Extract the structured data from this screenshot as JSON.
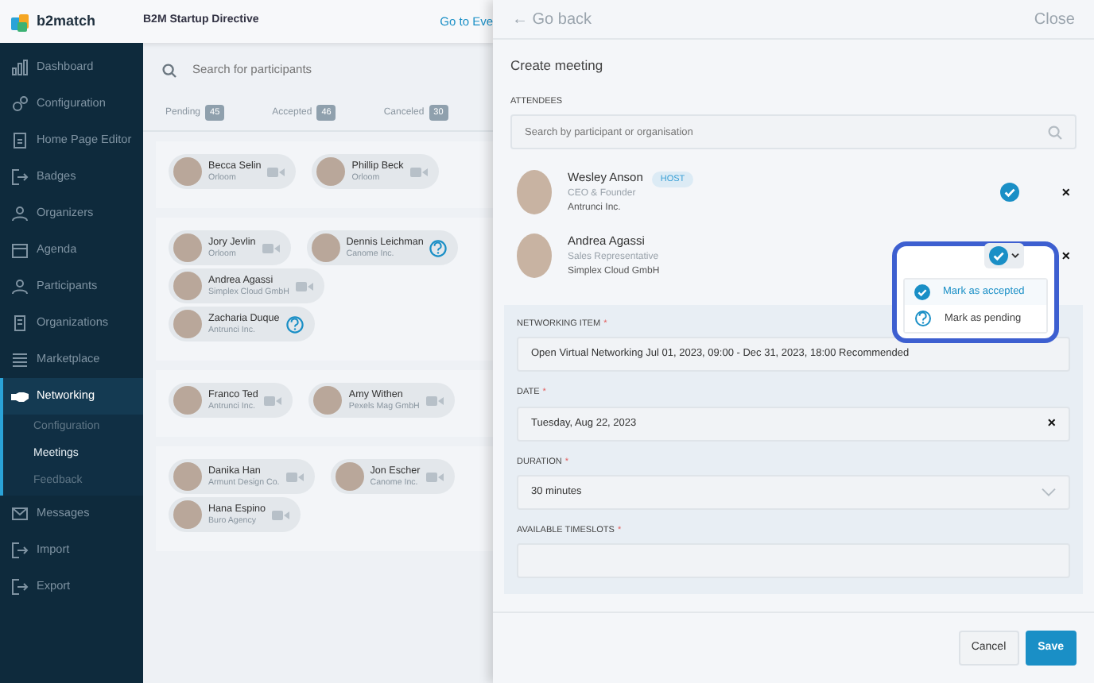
{
  "header": {
    "logo": "b2match",
    "event_title": "B2M Startup Directive",
    "link": "Go to Eve"
  },
  "sidebar": {
    "items": [
      {
        "label": "Dashboard",
        "selected": false
      },
      {
        "label": "Configuration",
        "selected": false
      },
      {
        "label": "Home Page Editor",
        "selected": false
      },
      {
        "label": "Badges",
        "selected": false
      },
      {
        "label": "Organizers",
        "selected": false
      },
      {
        "label": "Agenda",
        "selected": false
      },
      {
        "label": "Participants",
        "selected": false
      },
      {
        "label": "Organizations",
        "selected": false
      },
      {
        "label": "Marketplace",
        "selected": false
      },
      {
        "label": "Networking",
        "selected": true,
        "children": [
          {
            "label": "Configuration",
            "selected": false
          },
          {
            "label": "Meetings",
            "selected": true
          },
          {
            "label": "Feedback",
            "selected": false
          }
        ]
      },
      {
        "label": "Messages",
        "selected": false
      },
      {
        "label": "Import",
        "selected": false
      },
      {
        "label": "Export",
        "selected": false
      }
    ]
  },
  "meetings": {
    "search": {
      "placeholder": "Search for participants"
    },
    "tabs": [
      {
        "label": "Pending",
        "count": "45",
        "selected": false
      },
      {
        "label": "Accepted",
        "count": "46",
        "selected": false
      },
      {
        "label": "Canceled",
        "count": "30",
        "selected": false
      }
    ],
    "groups": [
      {
        "participants": [
          {
            "name": "Becca Selin",
            "org": "Orloom",
            "kind": "video"
          },
          {
            "name": "Phillip Beck",
            "org": "Orloom",
            "kind": "video"
          }
        ]
      },
      {
        "participants": [
          {
            "name": "Jory Jevlin",
            "org": "Orloom",
            "kind": "video"
          },
          {
            "name": "Dennis Leichman",
            "org": "Canome Inc.",
            "kind": "pending"
          },
          {
            "name": "Andrea Agassi",
            "org": "Simplex Cloud GmbH",
            "kind": "video"
          },
          {
            "name": "Zacharia Duque",
            "org": "Antrunci Inc.",
            "kind": "pending"
          }
        ]
      },
      {
        "participants": [
          {
            "name": "Franco Ted",
            "org": "Antrunci Inc.",
            "kind": "video"
          },
          {
            "name": "Amy Withen",
            "org": "Pexels Mag GmbH",
            "kind": "video"
          }
        ]
      },
      {
        "participants": [
          {
            "name": "Danika Han",
            "org": "Armunt Design Co.",
            "kind": "video"
          },
          {
            "name": "Jon Escher",
            "org": "Canome Inc.",
            "kind": "video"
          },
          {
            "name": "Hana Espino",
            "org": "Buro Agency",
            "kind": "video"
          }
        ]
      }
    ]
  },
  "panel": {
    "back": "← Go back",
    "close": "Close",
    "title": "Create meeting",
    "attendees_label": "ATTENDEES",
    "attendee_search": {
      "placeholder": "Search by participant or organisation"
    },
    "attendees": [
      {
        "name": "Wesley Anson",
        "badge": "HOST",
        "role": "CEO & Founder",
        "org": "Antrunci Inc.",
        "accepted": true,
        "expanded": false,
        "remove": "×"
      },
      {
        "name": "Andrea Agassi",
        "role": "Sales Representative",
        "org": "Simplex Cloud GmbH",
        "accepted": true,
        "expanded": true,
        "remove": "×"
      }
    ],
    "status_menu": [
      {
        "label": "Mark as accepted",
        "kind": "accepted",
        "selected": true
      },
      {
        "label": "Mark as pending",
        "kind": "pending",
        "selected": false
      }
    ],
    "fields": [
      {
        "label": "NETWORKING ITEM",
        "required_mark": "*",
        "value": "Open Virtual Networking Jul 01, 2023, 09:00 - Dec 31, 2023, 18:00 Recommended",
        "kind": "text"
      },
      {
        "label": "DATE",
        "required_mark": "*",
        "value": "Tuesday, Aug 22, 2023",
        "kind": "clearable",
        "clear": "×"
      },
      {
        "label": "DURATION",
        "required_mark": "*",
        "value": "30 minutes",
        "kind": "select"
      },
      {
        "label": "AVAILABLE TIMESLOTS",
        "required_mark": "*",
        "kind": "text"
      }
    ],
    "buttons": [
      {
        "label": "Cancel",
        "kind": "secondary"
      },
      {
        "label": "Save",
        "kind": "primary"
      }
    ]
  }
}
